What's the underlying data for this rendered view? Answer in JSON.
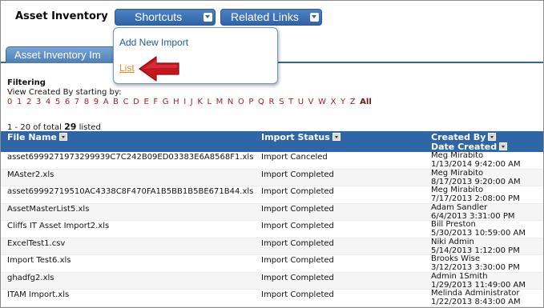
{
  "header": {
    "app_title": "Asset Inventory",
    "shortcuts_label": "Shortcuts",
    "related_links_label": "Related Links"
  },
  "tab": {
    "label": "Asset Inventory Im"
  },
  "dropdown": {
    "items": [
      "Add New Import",
      "List"
    ]
  },
  "filtering": {
    "title": "Filtering",
    "view_label": "View Created By starting by:",
    "letters": [
      "0",
      "1",
      "2",
      "3",
      "4",
      "5",
      "6",
      "7",
      "8",
      "9",
      "A",
      "B",
      "C",
      "D",
      "E",
      "F",
      "G",
      "H",
      "I",
      "J",
      "K",
      "L",
      "M",
      "N",
      "O",
      "P",
      "Q",
      "R",
      "S",
      "T",
      "U",
      "V",
      "W",
      "X",
      "Y",
      "Z",
      "All"
    ]
  },
  "listing": {
    "prefix": "1 - 20 of total",
    "total": "29",
    "suffix": "listed"
  },
  "table": {
    "headers": {
      "file_name": "File Name",
      "import_status": "Import Status",
      "created_by": "Created By",
      "date_created": "Date Created"
    },
    "rows": [
      {
        "file": "asset6999271973299939C7C242B09ED03383E6A8568F1.xls",
        "status": "Import Canceled",
        "user": "Meg Mirabito",
        "date": "1/13/2014 9:42:00 AM"
      },
      {
        "file": "MAster2.xls",
        "status": "Import Completed",
        "user": "Meg Mirabito",
        "date": "8/17/2013 9:20:00 AM"
      },
      {
        "file": "asset69992719510AC4338C8F470FA1B5BB1B5BE671B44.xls",
        "status": "Import Completed",
        "user": "Meg Mirabito",
        "date": "7/17/2013 2:08:00 PM"
      },
      {
        "file": "AssetMasterList5.xls",
        "status": "Import Completed",
        "user": "Adam Sandler",
        "date": "6/4/2013 3:31:00 PM"
      },
      {
        "file": "Cliffs IT Asset Import2.xls",
        "status": "Import Completed",
        "user": "Bill Preston",
        "date": "5/30/2013 10:59:00 AM"
      },
      {
        "file": "ExcelTest1.csv",
        "status": "Import Completed",
        "user": "Niki Admin",
        "date": "5/14/2013 1:12:00 PM"
      },
      {
        "file": "Import Test6.xls",
        "status": "Import Completed",
        "user": "Brooks Wise",
        "date": "3/12/2013 3:30:00 PM"
      },
      {
        "file": "ghadfg2.xls",
        "status": "Import Completed",
        "user": "Admin 1Smith",
        "date": "1/29/2013 11:49:00 AM"
      },
      {
        "file": "ITAM Import.xls",
        "status": "Import Completed",
        "user": "Melinda Administrator",
        "date": "1/22/2013 8:43:00 AM"
      }
    ]
  },
  "colors": {
    "button_blue": "#2f65a8",
    "header_blue": "#2f67a6",
    "letter_red": "#a01e2a",
    "link_orange": "#e08a1e",
    "arrow_red": "#c4161c"
  },
  "icons": {
    "caret": "chevron-down-icon",
    "sort": "sort-icon",
    "pointer": "red-arrow-icon"
  }
}
